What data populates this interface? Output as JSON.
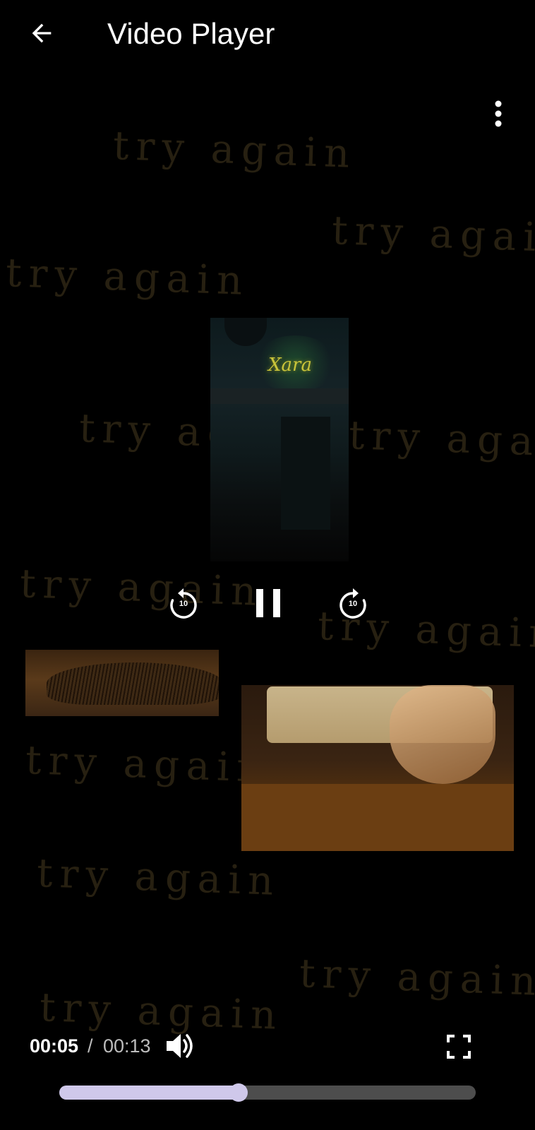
{
  "header": {
    "title": "Video Player",
    "back_icon": "arrow-left-icon",
    "more_icon": "more-vertical-icon"
  },
  "video": {
    "overlay_text": "try again",
    "neon_sign": "Xara",
    "skip_back_label": "10",
    "skip_forward_label": "10"
  },
  "player": {
    "current_time": "00:05",
    "separator": "/",
    "total_time": "00:13",
    "progress_fraction": 0.43,
    "volume_icon": "volume-icon",
    "fullscreen_icon": "fullscreen-icon"
  },
  "colors": {
    "background": "#000000",
    "seek_fill": "#cfc8ea",
    "seek_track": "#4d4d4d"
  }
}
